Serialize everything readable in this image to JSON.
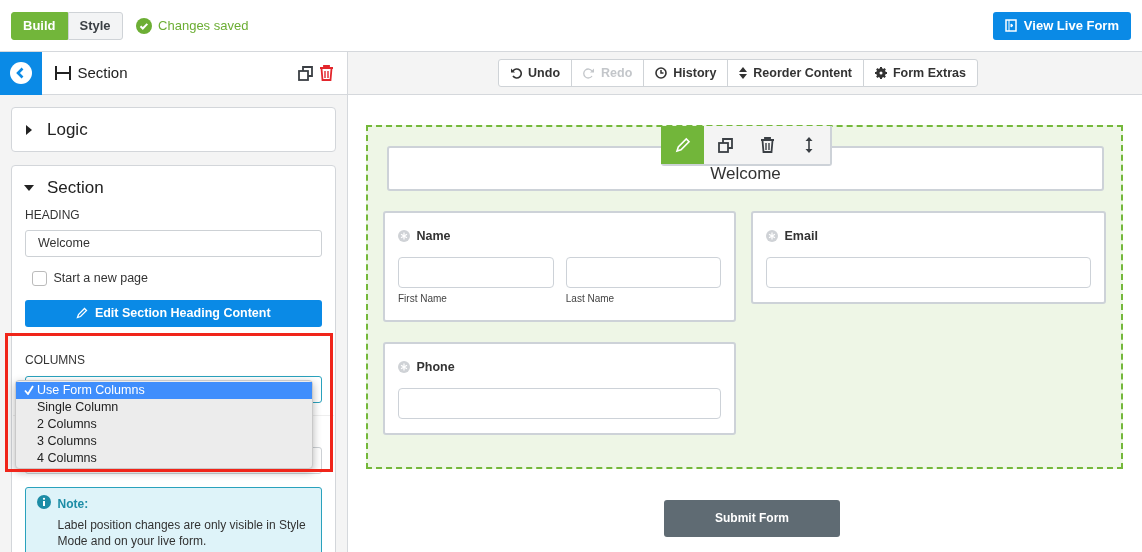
{
  "top_bar": {
    "mode_tabs": [
      {
        "label": "Build",
        "selected": true
      },
      {
        "label": "Style",
        "selected": false
      }
    ],
    "save_status": "Changes saved",
    "view_live_button": "View Live Form"
  },
  "sidebar": {
    "title": "Section",
    "panels": [
      {
        "title": "Logic",
        "expanded": false
      },
      {
        "title": "Section",
        "expanded": true
      }
    ],
    "heading_label": "HEADING",
    "heading_value": "Welcome",
    "new_page": {
      "label": "Start a new page",
      "checked": false
    },
    "edit_button": "Edit Section Heading Content",
    "columns_label": "COLUMNS",
    "columns_options": [
      {
        "label": "Use Form Columns",
        "selected": true
      },
      {
        "label": "Single Column",
        "selected": false
      },
      {
        "label": "2 Columns",
        "selected": false
      },
      {
        "label": "3 Columns",
        "selected": false
      },
      {
        "label": "4 Columns",
        "selected": false
      }
    ],
    "note": {
      "title": "Note:",
      "text": "Label position changes are only visible in Style Mode and on your live form."
    }
  },
  "toolbar": [
    {
      "label": "Undo",
      "kind": "undo",
      "disabled": false
    },
    {
      "label": "Redo",
      "kind": "redo",
      "disabled": true
    },
    {
      "label": "History",
      "kind": "history",
      "disabled": false
    },
    {
      "label": "Reorder Content",
      "kind": "reorder",
      "disabled": false
    },
    {
      "label": "Form Extras",
      "kind": "extras",
      "disabled": false
    }
  ],
  "canvas": {
    "heading": "Welcome",
    "fields": [
      {
        "label": "Name",
        "kind": "name",
        "sublabels": [
          "First Name",
          "Last Name"
        ]
      },
      {
        "label": "Email",
        "kind": "single"
      },
      {
        "label": "Phone",
        "kind": "single"
      }
    ],
    "submit_button": "Submit Form"
  }
}
